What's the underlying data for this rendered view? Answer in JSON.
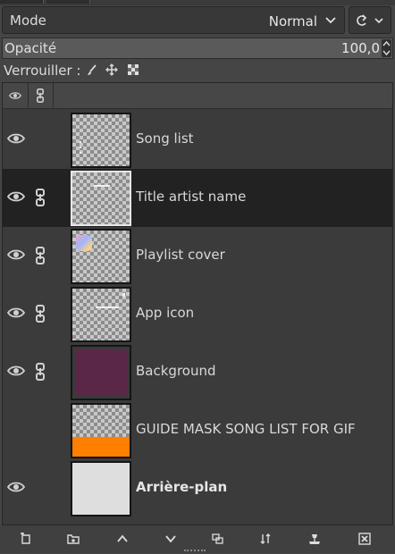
{
  "mode": {
    "label": "Mode",
    "value": "Normal"
  },
  "opacity": {
    "label": "Opacité",
    "value": "100,0"
  },
  "lock": {
    "label": "Verrouiller :"
  },
  "layers": [
    {
      "name": "Song list",
      "visible": true,
      "linked": false,
      "selected": false,
      "bold": false
    },
    {
      "name": "Title artist name",
      "visible": true,
      "linked": true,
      "selected": true,
      "bold": false
    },
    {
      "name": "Playlist cover",
      "visible": true,
      "linked": true,
      "selected": false,
      "bold": false
    },
    {
      "name": "App icon",
      "visible": true,
      "linked": true,
      "selected": false,
      "bold": false
    },
    {
      "name": "Background",
      "visible": true,
      "linked": true,
      "selected": false,
      "bold": false
    },
    {
      "name": "GUIDE MASK SONG LIST FOR GIF",
      "visible": false,
      "linked": false,
      "selected": false,
      "bold": false
    },
    {
      "name": "Arrière-plan",
      "visible": true,
      "linked": false,
      "selected": false,
      "bold": true
    }
  ],
  "toolbar": {
    "icons": [
      "new-layer-icon",
      "new-layer-group-icon",
      "raise-layer-icon",
      "lower-layer-icon",
      "duplicate-layer-icon",
      "merge-layer-icon",
      "anchor-layer-icon",
      "delete-layer-icon"
    ]
  },
  "colors": {
    "panel_bg": "#454545",
    "selected_row": "#222222",
    "orange": "#ff7f00",
    "purple": "#5a2748"
  }
}
